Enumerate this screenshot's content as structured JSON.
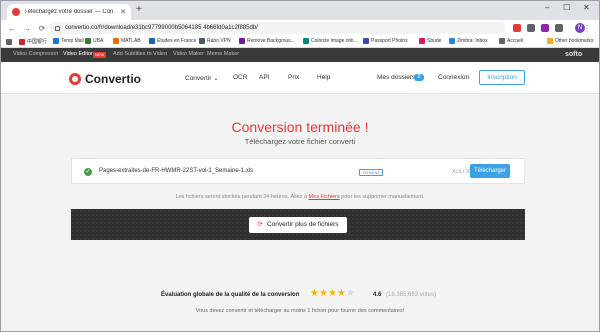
{
  "browser": {
    "tab_title": "Téléchargez votre dossier — Con",
    "tab_close": "✕",
    "new_tab": "+",
    "url": "convertio.co/fr/download/e31bc97799000b5064185 4b66fd0a1c2f885db/",
    "profile_initial": "N",
    "bookmarks": [
      "中国银行",
      "Temp Mail",
      "UBA",
      "MATLAB",
      "Études en France",
      "Rabo VPN",
      "Remove Backgrous...",
      "Colorize image onli...",
      "Passport Photos",
      "Sbude",
      "Zimbra: Inbox",
      "Accueil",
      "Other bookmarks"
    ],
    "extension_colors": [
      "#e53935",
      "#5f6368",
      "#8e24aa",
      "#5f6368"
    ]
  },
  "softo_bar": {
    "items": [
      "Video Compressor",
      "Video Editor",
      "Add Subtitles to Video",
      "Video Maker",
      "Meme Maker"
    ],
    "badge": "NEW",
    "logo": "softo"
  },
  "header": {
    "logo": "Convertio",
    "nav": [
      "Convertir",
      "OCR",
      "API",
      "Prix",
      "Help"
    ],
    "my_folders": "Mes dossiers",
    "my_folders_count": "0",
    "login": "Connexion",
    "signup": "Inscription"
  },
  "main": {
    "title": "Conversion terminée !",
    "subtitle": "Téléchargez votre fichier converti",
    "file": {
      "name": "Pages-extraites-de-FR-HWMR-22ST-vol-1_Semaine-1.xls",
      "status": "TERMINÉ",
      "size": "XLS / 100 KB",
      "download": "Télécharger"
    },
    "notice_before": "Les fichiers seront stockés pendant 24 heures. Allez à ",
    "notice_link": "Mes Fichiers",
    "notice_after": " pour les supprimer manuellement.",
    "convert_more": "Convertir plus de fichiers"
  },
  "rating": {
    "label": "Évaluation globale de la qualité de la conversion",
    "score": "4.6",
    "votes": "(18,365,663 votes)",
    "note": "Vous devez convertir et télécharger au moins 1 fichier pour fournir des commentaires!"
  },
  "colors": {
    "accent_red": "#e53935",
    "accent_blue": "#3ba0e6",
    "star": "#f4b400"
  }
}
